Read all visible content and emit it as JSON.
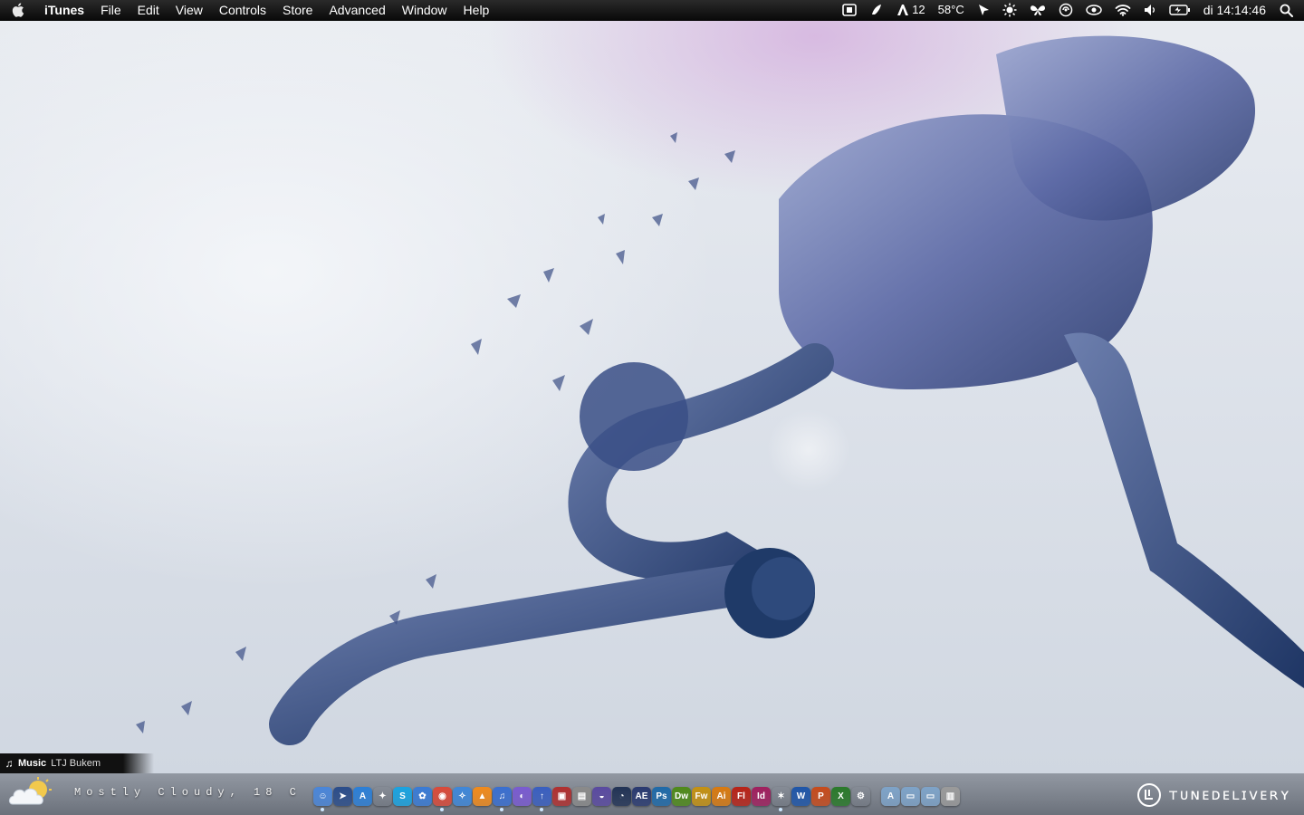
{
  "menubar": {
    "apple_icon": "apple-logo-icon",
    "app_name": "iTunes",
    "menus": [
      "File",
      "Edit",
      "View",
      "Controls",
      "Store",
      "Advanced",
      "Window",
      "Help"
    ],
    "status": {
      "adobe_count": "12",
      "temperature": "58°C",
      "clock": "di 14:14:46"
    }
  },
  "music_widget": {
    "label": "Music",
    "artist": "LTJ Bukem"
  },
  "weather_widget": {
    "condition": "Mostly Cloudy, 18 C",
    "icon": "partly-cloudy-icon"
  },
  "dock": {
    "apps": [
      {
        "name": "finder",
        "color": "#4a86d9",
        "glyph": "☺",
        "running": true
      },
      {
        "name": "cursor",
        "color": "#2b4d8a",
        "glyph": "➤",
        "running": false
      },
      {
        "name": "app-store",
        "color": "#2c7fd6",
        "glyph": "A",
        "running": false
      },
      {
        "name": "compass",
        "color": "#555",
        "glyph": "✦",
        "running": false
      },
      {
        "name": "skype",
        "color": "#1aa3e0",
        "glyph": "S",
        "running": false
      },
      {
        "name": "colloquy",
        "color": "#3a7bd5",
        "glyph": "✿",
        "running": false
      },
      {
        "name": "chrome",
        "color": "#d94a3a",
        "glyph": "◉",
        "running": true
      },
      {
        "name": "safari",
        "color": "#3f87d8",
        "glyph": "✧",
        "running": false
      },
      {
        "name": "vlc",
        "color": "#f08a1c",
        "glyph": "▲",
        "running": false
      },
      {
        "name": "itunes",
        "color": "#3a6fd0",
        "glyph": "♫",
        "running": true
      },
      {
        "name": "cyberduck",
        "color": "#7a5bd0",
        "glyph": "◐",
        "running": false
      },
      {
        "name": "transmit",
        "color": "#3a5fc0",
        "glyph": "↑",
        "running": true
      },
      {
        "name": "photo-booth",
        "color": "#b03030",
        "glyph": "▣",
        "running": false
      },
      {
        "name": "preview",
        "color": "#8a8a8a",
        "glyph": "▤",
        "running": false
      },
      {
        "name": "dashboard",
        "color": "#5a4aa0",
        "glyph": "◒",
        "running": false
      },
      {
        "name": "time-machine",
        "color": "#223355",
        "glyph": "◔",
        "running": false
      },
      {
        "name": "after-effects",
        "color": "#2a3a70",
        "glyph": "AE",
        "running": false
      },
      {
        "name": "photoshop",
        "color": "#1f6aa8",
        "glyph": "Ps",
        "running": false
      },
      {
        "name": "dreamweaver",
        "color": "#4f8a1a",
        "glyph": "Dw",
        "running": false
      },
      {
        "name": "fireworks",
        "color": "#c49112",
        "glyph": "Fw",
        "running": false
      },
      {
        "name": "illustrator",
        "color": "#d87a10",
        "glyph": "Ai",
        "running": false
      },
      {
        "name": "flash",
        "color": "#b82318",
        "glyph": "Fl",
        "running": false
      },
      {
        "name": "indesign",
        "color": "#a0205e",
        "glyph": "Id",
        "running": false
      },
      {
        "name": "sparkle",
        "color": "#555",
        "glyph": "✶",
        "running": true
      },
      {
        "name": "word",
        "color": "#1f56a8",
        "glyph": "W",
        "running": false
      },
      {
        "name": "powerpoint",
        "color": "#c64b1c",
        "glyph": "P",
        "running": false
      },
      {
        "name": "excel",
        "color": "#2a7a2a",
        "glyph": "X",
        "running": false
      },
      {
        "name": "system-preferences",
        "color": "#777",
        "glyph": "⚙",
        "running": false
      }
    ],
    "stacks": [
      {
        "name": "applications-folder",
        "color": "#7ea3c8",
        "glyph": "A"
      },
      {
        "name": "documents-folder",
        "color": "#7ea3c8",
        "glyph": "▭"
      },
      {
        "name": "downloads-folder",
        "color": "#7ea3c8",
        "glyph": "▭"
      },
      {
        "name": "trash",
        "color": "#9a9a9a",
        "glyph": "▥"
      }
    ]
  }
}
